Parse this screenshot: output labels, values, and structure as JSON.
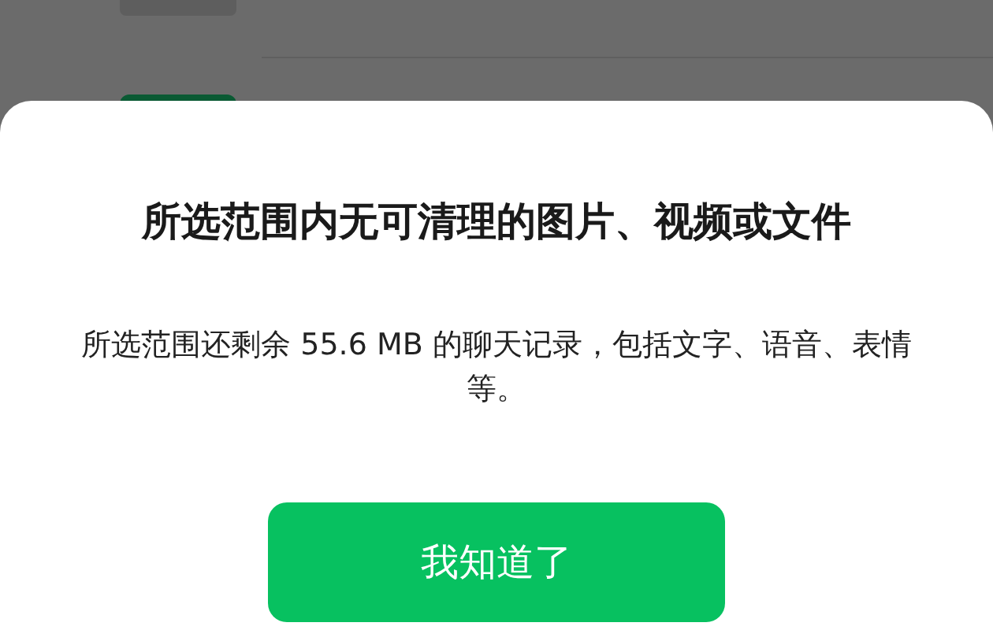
{
  "dialog": {
    "title": "所选范围内无可清理的图片、视频或文件",
    "message": "所选范围还剩余 55.6 MB 的聊天记录，包括文字、语音、表情等。",
    "button": "我知道了"
  }
}
